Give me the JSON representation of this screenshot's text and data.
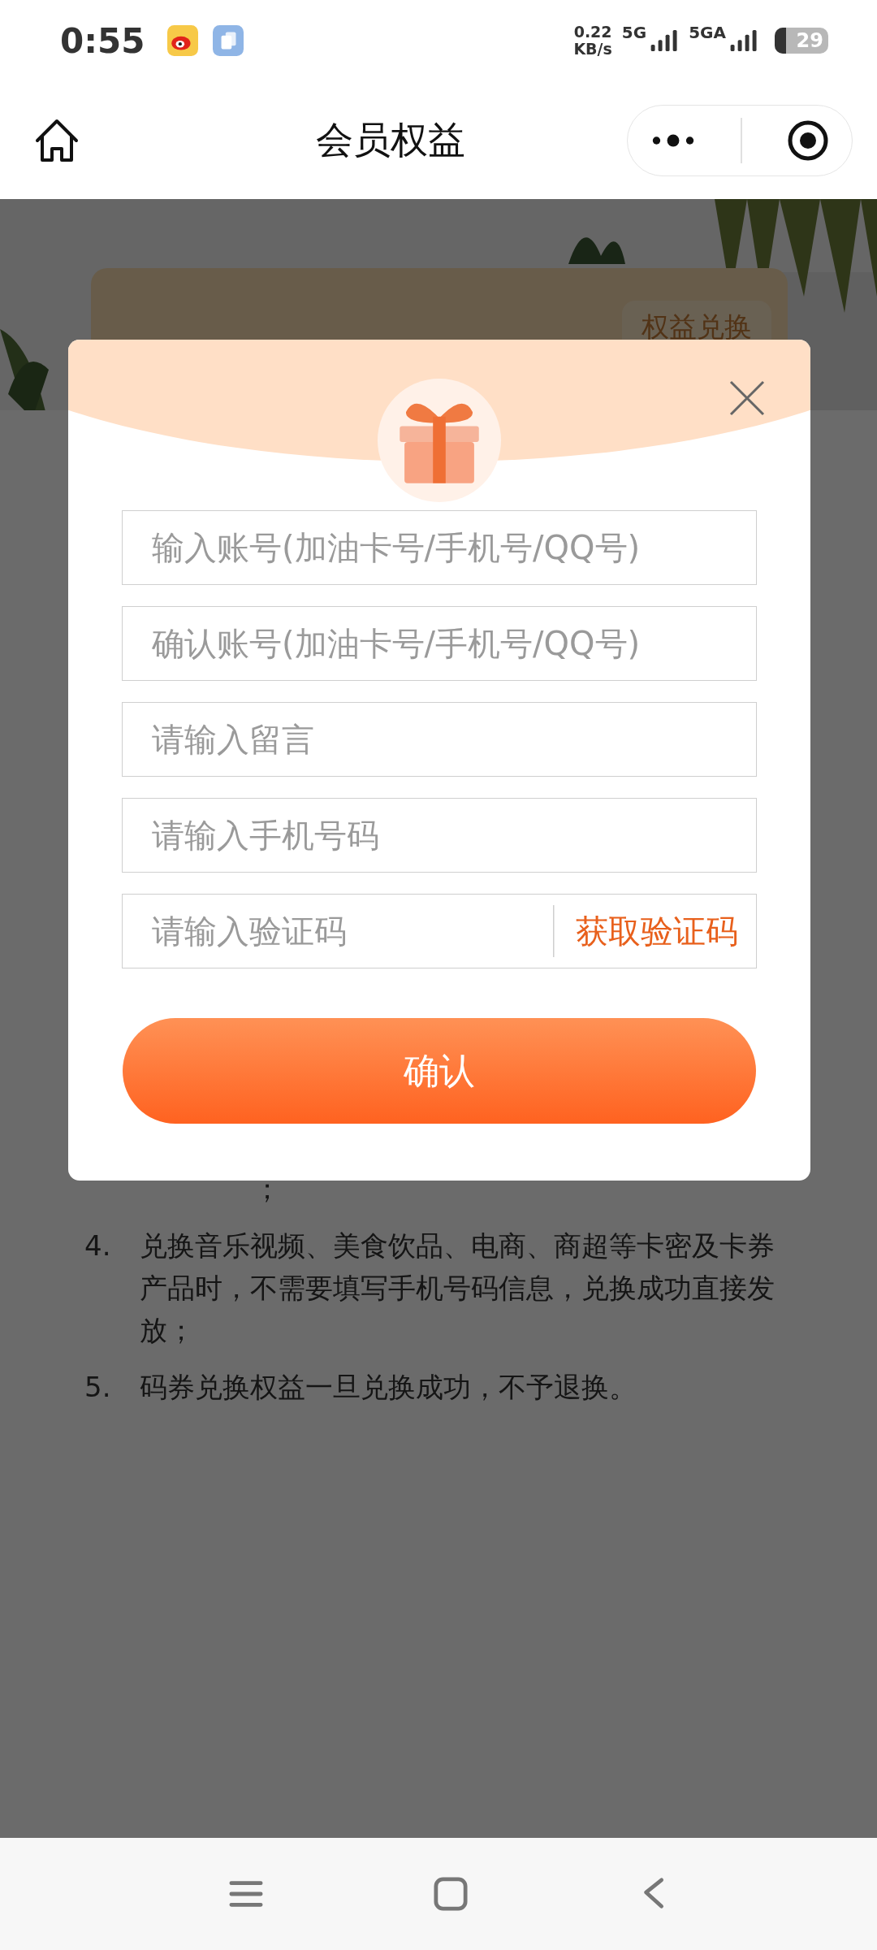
{
  "status_bar": {
    "time": "0:55",
    "net_speed": "0.22",
    "net_unit": "KB/s",
    "network_1": "5G",
    "network_2": "5GA",
    "battery": "29"
  },
  "nav": {
    "title": "会员权益"
  },
  "page": {
    "card_button": "权益兑换",
    "continued_text": "；",
    "rules": [
      {
        "number": "4.",
        "text": "兑换音乐视频、美食饮品、电商、商超等卡密及卡券产品时，不需要填写手机号码信息，兑换成功直接发放；"
      },
      {
        "number": "5.",
        "text": "码券兑换权益一旦兑换成功，不予退换。"
      }
    ]
  },
  "dialog": {
    "fields": [
      {
        "placeholder": "输入账号(加油卡号/手机号/QQ号)"
      },
      {
        "placeholder": "确认账号(加油卡号/手机号/QQ号)"
      },
      {
        "placeholder": "请输入留言"
      },
      {
        "placeholder": "请输入手机号码"
      },
      {
        "placeholder": "请输入验证码",
        "action": "获取验证码"
      }
    ],
    "confirm": "确认"
  }
}
